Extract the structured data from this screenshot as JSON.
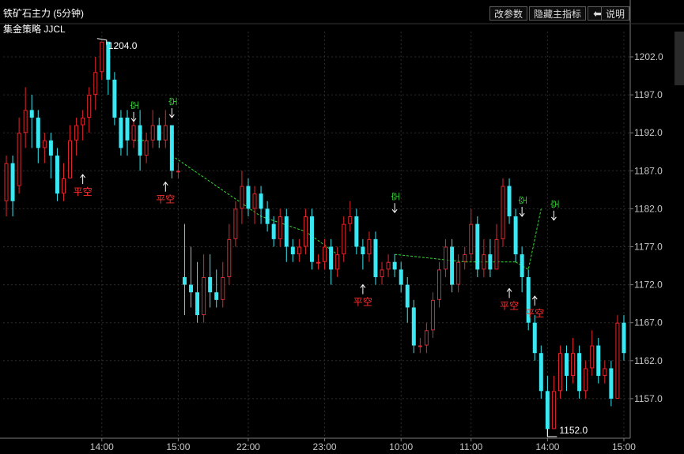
{
  "header": {
    "title": "铁矿石主力 (5分钟)",
    "subtitle": "集金策略 JJCL"
  },
  "toolbar": {
    "params_label": "改参数",
    "hide_label": "隐藏主指标",
    "left_arrow": "⬅",
    "right_arrow": "➡",
    "help_label": "说明"
  },
  "colors": {
    "up": "#e0262b",
    "down": "#39e8f2",
    "signal_line": "#30e030",
    "grid": "#2c2c2c"
  },
  "chart_data": {
    "type": "candlestick",
    "ylim": [
      1152.0,
      1205.0
    ],
    "ytick_labels": [
      "1202.0",
      "1197.0",
      "1192.0",
      "1187.0",
      "1182.0",
      "1177.0",
      "1172.0",
      "1167.0",
      "1162.0",
      "1157.0"
    ],
    "yticks": [
      1202,
      1197,
      1192,
      1187,
      1182,
      1177,
      1172,
      1167,
      1162,
      1157
    ],
    "xtick_labels": [
      "14:00",
      "15:00",
      "22:00",
      "23:00",
      "10:00",
      "11:00",
      "14:00",
      "15:00"
    ],
    "xtick_index": [
      15,
      27,
      38,
      50,
      62,
      73,
      85,
      97
    ],
    "annotations": [
      {
        "label": "1204.0",
        "index": 15,
        "price": 1204.0
      },
      {
        "label": "1152.0",
        "index": 85,
        "price": 1152.0
      }
    ],
    "candles": [
      [
        1183,
        1188,
        1181,
        1189
      ],
      [
        1188,
        1183,
        1181,
        1189
      ],
      [
        1185,
        1192,
        1184,
        1194
      ],
      [
        1192,
        1195,
        1190,
        1198
      ],
      [
        1195,
        1194,
        1190,
        1197
      ],
      [
        1194,
        1190,
        1188,
        1195
      ],
      [
        1190,
        1191,
        1188,
        1192
      ],
      [
        1191,
        1189,
        1186,
        1192
      ],
      [
        1189,
        1184,
        1183,
        1190
      ],
      [
        1184,
        1186,
        1183,
        1188
      ],
      [
        1186,
        1191,
        1186,
        1193
      ],
      [
        1191,
        1193,
        1189,
        1194
      ],
      [
        1193,
        1194,
        1191,
        1195
      ],
      [
        1194,
        1197,
        1192,
        1198
      ],
      [
        1197,
        1200,
        1195,
        1202
      ],
      [
        1200,
        1204,
        1199,
        1204
      ],
      [
        1204,
        1199,
        1197,
        1204
      ],
      [
        1199,
        1194,
        1193,
        1200
      ],
      [
        1194,
        1190,
        1189,
        1195
      ],
      [
        1194,
        1191,
        1189,
        1195
      ],
      [
        1191,
        1193,
        1190,
        1194
      ],
      [
        1193,
        1189,
        1187,
        1195
      ],
      [
        1189,
        1191,
        1188,
        1192
      ],
      [
        1191,
        1193,
        1190,
        1195
      ],
      [
        1193,
        1191,
        1190,
        1194
      ],
      [
        1191,
        1193,
        1190,
        1195
      ],
      [
        1193,
        1187,
        1186,
        1193
      ],
      [
        1187,
        1187,
        1186,
        1188
      ],
      [
        1173,
        1172,
        1168,
        1180
      ],
      [
        1172,
        1171,
        1169,
        1177
      ],
      [
        1171,
        1168,
        1167,
        1175
      ],
      [
        1168,
        1173,
        1167,
        1176
      ],
      [
        1173,
        1171,
        1169,
        1176
      ],
      [
        1171,
        1170,
        1169,
        1174
      ],
      [
        1170,
        1173,
        1169,
        1175
      ],
      [
        1173,
        1178,
        1172,
        1180
      ],
      [
        1178,
        1182,
        1177,
        1183
      ],
      [
        1182,
        1185,
        1180,
        1187
      ],
      [
        1185,
        1182,
        1181,
        1186
      ],
      [
        1182,
        1184,
        1180,
        1185
      ],
      [
        1184,
        1182,
        1180,
        1185
      ],
      [
        1182,
        1180,
        1179,
        1183
      ],
      [
        1180,
        1178,
        1177,
        1181
      ],
      [
        1178,
        1181,
        1177,
        1182
      ],
      [
        1181,
        1177,
        1175,
        1182
      ],
      [
        1177,
        1176,
        1175,
        1178
      ],
      [
        1176,
        1177,
        1175,
        1178
      ],
      [
        1177,
        1181,
        1176,
        1182
      ],
      [
        1181,
        1175,
        1174,
        1182
      ],
      [
        1175,
        1175,
        1174,
        1176
      ],
      [
        1175,
        1177,
        1174,
        1178
      ],
      [
        1177,
        1174,
        1172,
        1178
      ],
      [
        1174,
        1176,
        1173,
        1177
      ],
      [
        1176,
        1180,
        1175,
        1181
      ],
      [
        1180,
        1181,
        1179,
        1183
      ],
      [
        1181,
        1177,
        1176,
        1182
      ],
      [
        1177,
        1176,
        1174,
        1178
      ],
      [
        1176,
        1178,
        1175,
        1179
      ],
      [
        1178,
        1173,
        1172,
        1179
      ],
      [
        1173,
        1174,
        1172,
        1175
      ],
      [
        1174,
        1175,
        1173,
        1176
      ],
      [
        1175,
        1174,
        1173,
        1176
      ],
      [
        1174,
        1172,
        1171,
        1175
      ],
      [
        1172,
        1169,
        1167,
        1173
      ],
      [
        1169,
        1164,
        1163,
        1170
      ],
      [
        1164,
        1164,
        1163,
        1165
      ],
      [
        1164,
        1166,
        1163,
        1167
      ],
      [
        1166,
        1170,
        1165,
        1171
      ],
      [
        1170,
        1174,
        1169,
        1175
      ],
      [
        1174,
        1177,
        1173,
        1178
      ],
      [
        1177,
        1172,
        1171,
        1178
      ],
      [
        1172,
        1175,
        1171,
        1176
      ],
      [
        1175,
        1176,
        1174,
        1177
      ],
      [
        1176,
        1180,
        1175,
        1182
      ],
      [
        1180,
        1174,
        1173,
        1181
      ],
      [
        1174,
        1176,
        1173,
        1178
      ],
      [
        1176,
        1174,
        1173,
        1178
      ],
      [
        1174,
        1178,
        1174,
        1180
      ],
      [
        1178,
        1185,
        1177,
        1186
      ],
      [
        1185,
        1181,
        1180,
        1186
      ],
      [
        1181,
        1176,
        1175,
        1182
      ],
      [
        1176,
        1173,
        1171,
        1177
      ],
      [
        1173,
        1167,
        1166,
        1174
      ],
      [
        1167,
        1163,
        1162,
        1168
      ],
      [
        1163,
        1158,
        1157,
        1164
      ],
      [
        1158,
        1153,
        1152,
        1160
      ],
      [
        1153,
        1158,
        1153,
        1160
      ],
      [
        1158,
        1163,
        1157,
        1164
      ],
      [
        1163,
        1160,
        1158,
        1164
      ],
      [
        1160,
        1163,
        1159,
        1165
      ],
      [
        1163,
        1158,
        1157,
        1164
      ],
      [
        1158,
        1161,
        1157,
        1162
      ],
      [
        1161,
        1164,
        1160,
        1166
      ],
      [
        1164,
        1160,
        1159,
        1165
      ],
      [
        1160,
        1161,
        1159,
        1162
      ],
      [
        1161,
        1157,
        1156,
        1162
      ],
      [
        1157,
        1167,
        1157,
        1168
      ],
      [
        1167,
        1163,
        1162,
        1168
      ]
    ],
    "signals": [
      {
        "type": "平空",
        "index": 12,
        "price": 1186.5,
        "position": "below"
      },
      {
        "type": "空",
        "index": 20,
        "price": 1193.5,
        "position": "above"
      },
      {
        "type": "平空",
        "index": 25,
        "price": 1185.5,
        "position": "below"
      },
      {
        "type": "空",
        "index": 26,
        "price": 1194.0,
        "position": "above"
      },
      {
        "type": "平空",
        "index": 56,
        "price": 1172.0,
        "position": "below"
      },
      {
        "type": "空",
        "index": 61,
        "price": 1181.5,
        "position": "above"
      },
      {
        "type": "平空",
        "index": 79,
        "price": 1171.5,
        "position": "below"
      },
      {
        "type": "空",
        "index": 81,
        "price": 1181.0,
        "position": "above"
      },
      {
        "type": "平空",
        "index": 83,
        "price": 1170.5,
        "position": "below"
      },
      {
        "type": "空",
        "index": 86,
        "price": 1180.5,
        "position": "above"
      }
    ],
    "signal_line": [
      [
        [
          20,
          1191
        ],
        [
          22,
          1191
        ]
      ],
      [
        [
          26,
          1189
        ],
        [
          40,
          1181
        ],
        [
          47,
          1179
        ],
        [
          52,
          1176
        ]
      ],
      [
        [
          61,
          1176
        ],
        [
          72,
          1175
        ],
        [
          80,
          1175
        ]
      ],
      [
        [
          80,
          1175
        ],
        [
          82,
          1174
        ],
        [
          84,
          1182
        ]
      ]
    ]
  }
}
